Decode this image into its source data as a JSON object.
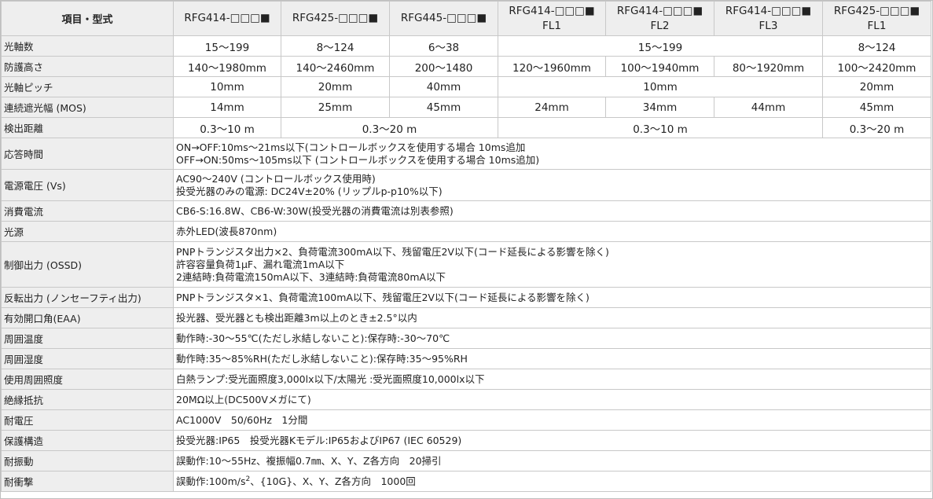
{
  "header": {
    "label": "項目・型式",
    "models": [
      {
        "line1": "RFG414-□□□■",
        "line2": ""
      },
      {
        "line1": "RFG425-□□□■",
        "line2": ""
      },
      {
        "line1": "RFG445-□□□■",
        "line2": ""
      },
      {
        "line1": "RFG414-□□□■",
        "line2": "FL1"
      },
      {
        "line1": "RFG414-□□□■",
        "line2": "FL2"
      },
      {
        "line1": "RFG414-□□□■",
        "line2": "FL3"
      },
      {
        "line1": "RFG425-□□□■",
        "line2": "FL1"
      }
    ]
  },
  "rows": {
    "beams": {
      "label": "光軸数",
      "values": [
        "15～199",
        "8～124",
        "6～38",
        "15～199",
        "8～124"
      ]
    },
    "height": {
      "label": "防護高さ",
      "values": [
        "140～1980mm",
        "140～2460mm",
        "200～1480",
        "120～1960mm",
        "100～1940mm",
        "80～1920mm",
        "100～2420mm"
      ]
    },
    "pitch": {
      "label": "光軸ピッチ",
      "values": [
        "10mm",
        "20mm",
        "40mm",
        "10mm",
        "20mm"
      ]
    },
    "mos": {
      "label": "連続遮光幅 (MOS)",
      "values": [
        "14mm",
        "25mm",
        "45mm",
        "24mm",
        "34mm",
        "44mm",
        "45mm"
      ]
    },
    "distance": {
      "label": "検出距離",
      "values": [
        "0.3～10 m",
        "0.3～20 m",
        "0.3～10 m",
        "0.3～20 m"
      ]
    },
    "response": {
      "label": "応答時間",
      "lines": [
        "ON→OFF:10ms～21ms以下(コントロールボックスを使用する場合 10ms追加",
        "OFF→ON:50ms～105ms以下 (コントロールボックスを使用する場合 10ms追加)"
      ]
    },
    "voltage": {
      "label": "電源電圧 (Vs)",
      "lines": [
        "AC90～240V (コントロールボックス使用時)",
        "投受光器のみの電源: DC24V±20% (リップルp-p10%以下)"
      ]
    },
    "current": {
      "label": "消費電流",
      "lines": [
        "CB6-S:16.8W、CB6-W:30W(投受光器の消費電流は別表参照)"
      ]
    },
    "source": {
      "label": "光源",
      "lines": [
        "赤外LED(波長870nm)"
      ]
    },
    "ossd": {
      "label": "制御出力 (OSSD)",
      "lines": [
        "PNPトランジスタ出力×2、負荷電流300mA以下、残留電圧2V以下(コード延長による影響を除く)",
        "許容容量負荷1μF、漏れ電流1mA以下",
        "2連結時:負荷電流150mA以下、3連結時:負荷電流80mA以下"
      ]
    },
    "reverse": {
      "label": "反転出力 (ノンセーフティ出力)",
      "lines": [
        "PNPトランジスタ×1、負荷電流100mA以下、残留電圧2V以下(コード延長による影響を除く)"
      ]
    },
    "eaa": {
      "label": "有効開口角(EAA)",
      "lines": [
        "投光器、受光器とも検出距離3m以上のとき±2.5°以内"
      ]
    },
    "temp": {
      "label": "周囲温度",
      "lines": [
        "動作時:-30～55℃(ただし氷結しないこと):保存時:-30～70℃"
      ]
    },
    "humidity": {
      "label": "周囲湿度",
      "lines": [
        "動作時:35～85%RH(ただし氷結しないこと):保存時:35～95%RH"
      ]
    },
    "illum": {
      "label": "使用周囲照度",
      "lines": [
        "白熱ランプ:受光面照度3,000lx以下/太陽光 :受光面照度10,000lx以下"
      ]
    },
    "insulation": {
      "label": "絶縁抵抗",
      "lines": [
        "20MΩ以上(DC500Vメガにて)"
      ]
    },
    "withstand": {
      "label": "耐電圧",
      "lines": [
        "AC1000V　50/60Hz　1分間"
      ]
    },
    "protection": {
      "label": "保護構造",
      "lines": [
        "投受光器:IP65　投受光器Kモデル:IP65およびIP67 (IEC 60529)"
      ]
    },
    "vibration": {
      "label": "耐振動",
      "lines": [
        "誤動作:10～55Hz、複振幅0.7㎜、X、Y、Z各方向　20掃引"
      ]
    },
    "shock": {
      "label": "耐衝撃",
      "pre": "誤動作:100m/s",
      "sup": "2",
      "post": "、{10G}、X、Y、Z各方向　1000回"
    }
  }
}
